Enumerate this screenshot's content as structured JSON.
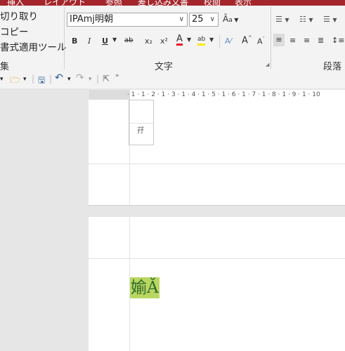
{
  "menubar": {
    "items": [
      "挿入",
      "レイアウト",
      "参照",
      "差し込み文書",
      "校閲",
      "表示"
    ]
  },
  "clipboard": {
    "cut": "切り取り",
    "copy": "コピー",
    "format_painter": "書式適用ツール",
    "group_label": "集"
  },
  "font": {
    "name": "IPAmj明朝",
    "size": "25",
    "group_label": "文字",
    "bold": "B",
    "italic": "I",
    "underline": "U",
    "strike": "ab",
    "subscript": "x₂",
    "superscript": "x²",
    "font_color_letter": "A",
    "highlight_letter": "ab",
    "grow": "A",
    "shrink": "A"
  },
  "paragraph": {
    "group_label": "段落"
  },
  "ruler": {
    "text": "· 1 · 1 · 2 · 1 · 3 · 1 · 4 · 1 · 5 · 1 · 6 · 1 · 7 · 1 · 8 · 1 · 9 · 1 · 10"
  },
  "document": {
    "page1_char": "孖",
    "page2_text": "媮Ă"
  },
  "colors": {
    "accent": "#a4262c",
    "font_color": "#e81123",
    "highlight": "#ffe600",
    "selection": "#b9d660",
    "text_color": "#2f6b2f"
  }
}
